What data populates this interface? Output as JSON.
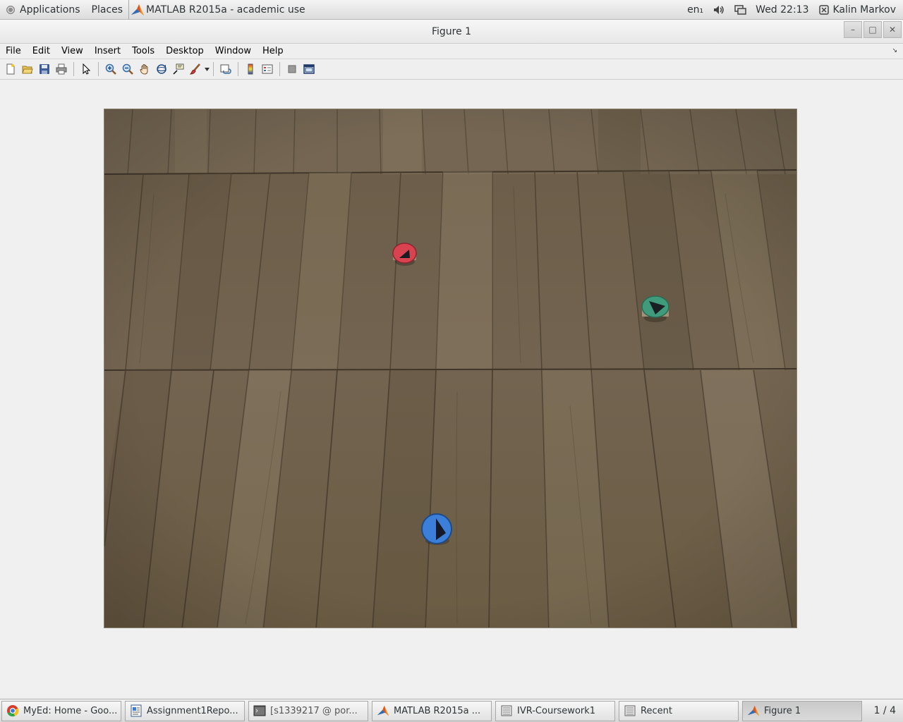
{
  "top_panel": {
    "applications_label": "Applications",
    "places_label": "Places",
    "active_task_label": "MATLAB R2015a - academic use",
    "keyboard_layout": "en₁",
    "clock": "Wed 22:13",
    "user_name": "Kalin Markov"
  },
  "window": {
    "title": "Figure 1",
    "minimize_symbol": "–",
    "maximize_symbol": "□",
    "close_symbol": "✕"
  },
  "menu": {
    "file": "File",
    "edit": "Edit",
    "view": "View",
    "insert": "Insert",
    "tools": "Tools",
    "desktop": "Desktop",
    "window": "Window",
    "help": "Help"
  },
  "toolbar": {
    "icons": [
      "new-figure-icon",
      "open-file-icon",
      "save-icon",
      "print-icon",
      "edit-plot-pointer-icon",
      "zoom-in-icon",
      "zoom-out-icon",
      "pan-hand-icon",
      "rotate-3d-icon",
      "data-cursor-icon",
      "brush-icon",
      "link-plot-icon",
      "colorbar-icon",
      "legend-icon",
      "hide-plot-tools-icon",
      "show-plot-tools-icon"
    ]
  },
  "image": {
    "description_colors": {
      "floor": "#6f604b",
      "red_marker": "#d8434f",
      "green_marker": "#3f9b7b",
      "blue_marker": "#3b7fd8"
    }
  },
  "taskbar": {
    "tasks": [
      {
        "label": "MyEd: Home - Goo...",
        "icon": "chrome-icon"
      },
      {
        "label": "Assignment1Repo...",
        "icon": "document-icon"
      },
      {
        "label": "[s1339217 @ por...",
        "icon": "terminal-icon"
      },
      {
        "label": "MATLAB R2015a ...",
        "icon": "matlab-icon"
      },
      {
        "label": "IVR-Coursework1",
        "icon": "file-manager-icon"
      },
      {
        "label": "Recent",
        "icon": "file-manager-icon"
      },
      {
        "label": "Figure 1",
        "icon": "matlab-icon"
      }
    ],
    "pager": "1 / 4"
  }
}
